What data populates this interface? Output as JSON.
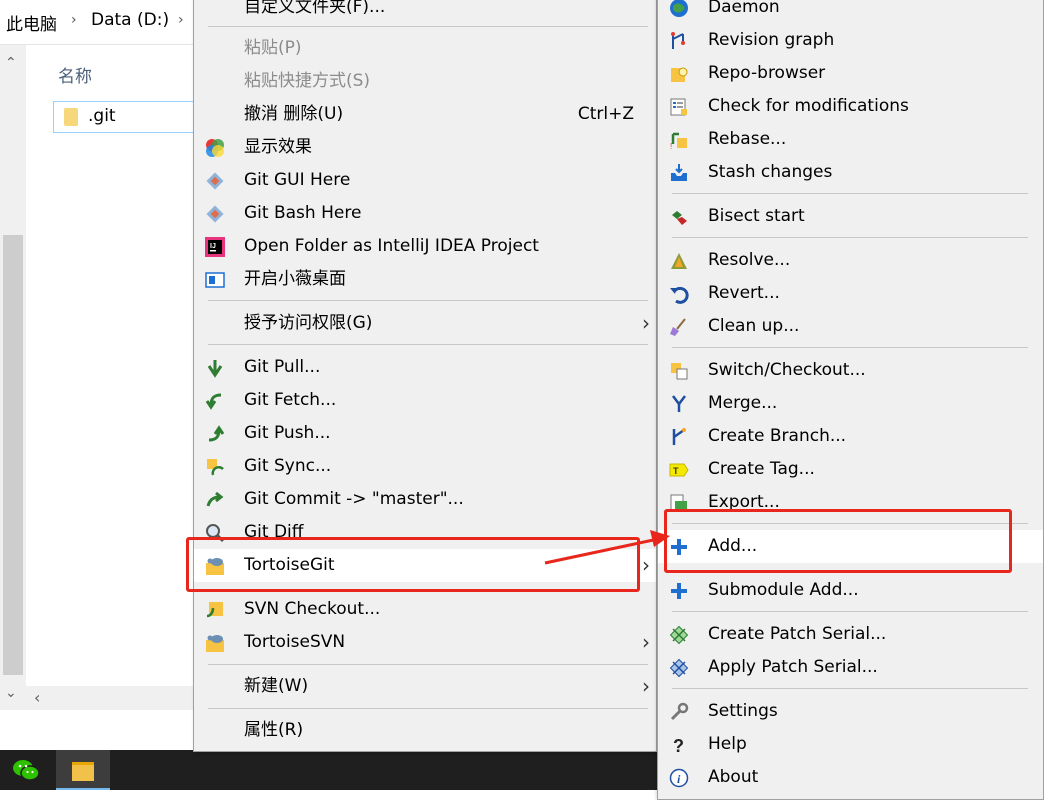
{
  "explorer": {
    "breadcrumb": [
      "此电脑",
      "Data (D:)"
    ],
    "column_header": "名称",
    "folder_name": ".git"
  },
  "context_menu": {
    "items": [
      {
        "label": "自定义文件夹(F)...",
        "enabled": true
      },
      {
        "label": "粘贴(P)",
        "enabled": false
      },
      {
        "label": "粘贴快捷方式(S)",
        "enabled": false
      },
      {
        "label": "撤消 删除(U)",
        "shortcut": "Ctrl+Z",
        "enabled": true
      },
      {
        "label": "显示效果",
        "icon": "color-effects-icon"
      },
      {
        "label": "Git GUI Here",
        "icon": "git-gui-icon"
      },
      {
        "label": "Git Bash Here",
        "icon": "git-bash-icon"
      },
      {
        "label": "Open Folder as IntelliJ IDEA Project",
        "icon": "intellij-icon"
      },
      {
        "label": "开启小薇桌面",
        "icon": "desktop-icon"
      },
      {
        "label": "授予访问权限(G)",
        "submenu": true
      },
      {
        "label": "Git Pull...",
        "icon": "git-pull-icon"
      },
      {
        "label": "Git Fetch...",
        "icon": "git-fetch-icon"
      },
      {
        "label": "Git Push...",
        "icon": "git-push-icon"
      },
      {
        "label": "Git Sync...",
        "icon": "git-sync-icon"
      },
      {
        "label": "Git Commit -> \"master\"...",
        "icon": "git-commit-icon"
      },
      {
        "label": "Git Diff",
        "icon": "git-diff-icon"
      },
      {
        "label": "TortoiseGit",
        "icon": "tortoisegit-icon",
        "submenu": true,
        "highlighted": true
      },
      {
        "label": "SVN Checkout...",
        "icon": "svn-checkout-icon"
      },
      {
        "label": "TortoiseSVN",
        "icon": "tortoisesvn-icon",
        "submenu": true
      },
      {
        "label": "新建(W)",
        "submenu": true
      },
      {
        "label": "属性(R)"
      }
    ]
  },
  "tortoisegit_submenu": {
    "items": [
      {
        "label": "Daemon",
        "icon": "daemon-icon"
      },
      {
        "label": "Revision graph",
        "icon": "revision-graph-icon"
      },
      {
        "label": "Repo-browser",
        "icon": "repo-browser-icon"
      },
      {
        "label": "Check for modifications",
        "icon": "check-modifications-icon"
      },
      {
        "label": "Rebase...",
        "icon": "rebase-icon"
      },
      {
        "label": "Stash changes",
        "icon": "stash-icon"
      },
      {
        "label": "Bisect start",
        "icon": "bisect-icon"
      },
      {
        "label": "Resolve...",
        "icon": "resolve-icon"
      },
      {
        "label": "Revert...",
        "icon": "revert-icon"
      },
      {
        "label": "Clean up...",
        "icon": "cleanup-icon"
      },
      {
        "label": "Switch/Checkout...",
        "icon": "switch-icon"
      },
      {
        "label": "Merge...",
        "icon": "merge-icon"
      },
      {
        "label": "Create Branch...",
        "icon": "branch-icon"
      },
      {
        "label": "Create Tag...",
        "icon": "tag-icon"
      },
      {
        "label": "Export...",
        "icon": "export-icon"
      },
      {
        "label": "Add...",
        "icon": "add-icon",
        "highlighted": true
      },
      {
        "label": "Submodule Add...",
        "icon": "add-icon"
      },
      {
        "label": "Create Patch Serial...",
        "icon": "patch-icon"
      },
      {
        "label": "Apply Patch Serial...",
        "icon": "apply-patch-icon"
      },
      {
        "label": "Settings",
        "icon": "wrench-icon"
      },
      {
        "label": "Help",
        "icon": "help-icon"
      },
      {
        "label": "About",
        "icon": "info-icon"
      }
    ]
  },
  "colors": {
    "menu_bg": "#f0f0f0",
    "highlight_bg": "#ffffff",
    "annotation_red": "#e8261c",
    "taskbar": "#1f1f1f"
  }
}
